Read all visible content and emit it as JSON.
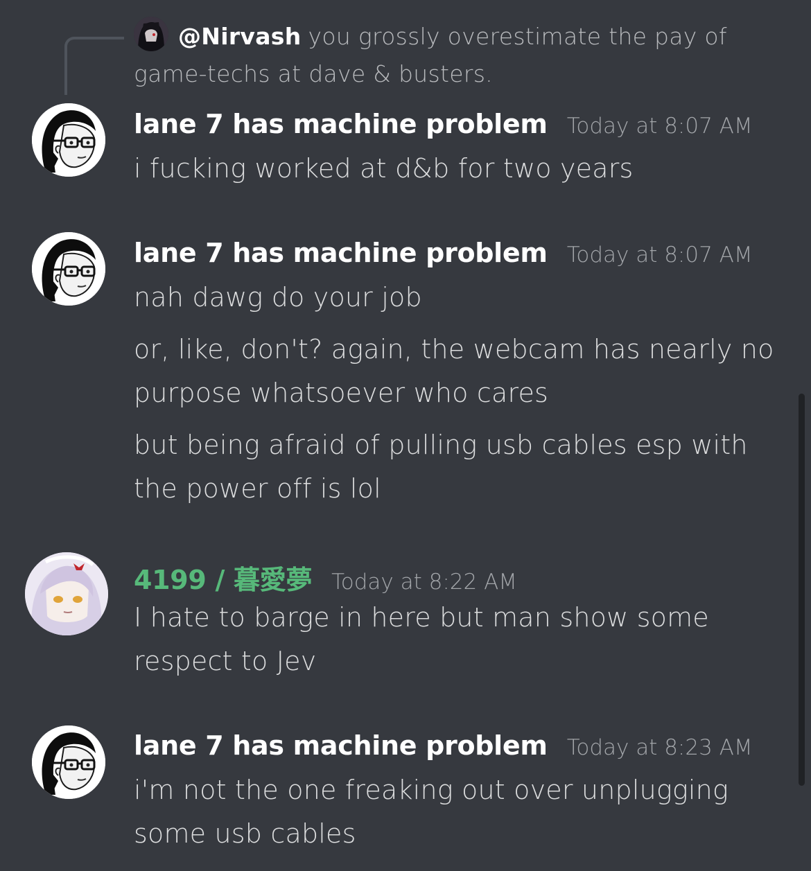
{
  "reply": {
    "mention": "@Nirvash",
    "text": "you grossly overestimate the pay of game-techs at dave & busters."
  },
  "messages": [
    {
      "author": "lane 7 has machine problem",
      "timestamp": "Today at 8:07 AM",
      "lines": [
        "i fucking worked at d&b for two years"
      ]
    },
    {
      "author": "lane 7 has machine problem",
      "timestamp": "Today at 8:07 AM",
      "lines": [
        "nah dawg do your job",
        "or, like, don't? again, the webcam has nearly no",
        "purpose whatsoever who cares",
        "but being afraid of pulling usb cables esp with",
        "the power off is lol"
      ]
    },
    {
      "author": "4199 / 暮愛夢",
      "author_color": "#57b97a",
      "timestamp": "Today at 8:22 AM",
      "lines": [
        "I hate to barge in here but man show some",
        "respect to Jev"
      ]
    },
    {
      "author": "lane 7 has machine problem",
      "timestamp": "Today at 8:23 AM",
      "lines": [
        "i'm not the one freaking out over unplugging",
        "some usb cables"
      ]
    }
  ],
  "colors": {
    "background": "#36393f",
    "username": "#ffffff",
    "role_green": "#57b97a",
    "text": "#dcddde",
    "muted": "#a3a6aa"
  }
}
